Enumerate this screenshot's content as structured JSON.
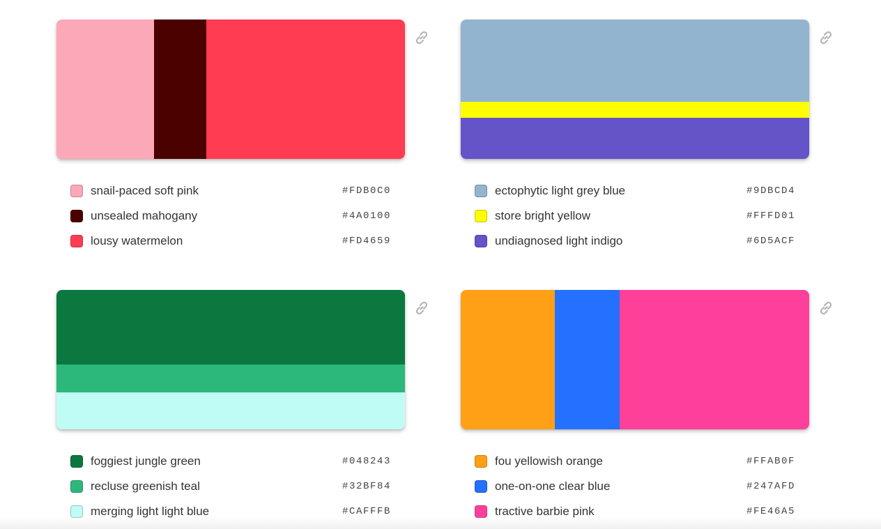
{
  "palettes": [
    {
      "orientation": "horizontal",
      "colors": [
        {
          "name": "snail-paced soft pink",
          "hex": "#FDB0C0",
          "color": "#FDA8B8",
          "share": 28
        },
        {
          "name": "unsealed mahogany",
          "hex": "#4A0100",
          "color": "#4A0100",
          "share": 15
        },
        {
          "name": "lousy watermelon",
          "hex": "#FD4659",
          "color": "#FF3C52",
          "share": 57
        }
      ]
    },
    {
      "orientation": "vertical",
      "colors": [
        {
          "name": "ectophytic light grey blue",
          "hex": "#9DBCD4",
          "color": "#93B4CF",
          "share": 59
        },
        {
          "name": "store bright yellow",
          "hex": "#FFFD01",
          "color": "#FFFD01",
          "share": 11.5
        },
        {
          "name": "undiagnosed light indigo",
          "hex": "#6D5ACF",
          "color": "#6553C8",
          "share": 29.5
        }
      ]
    },
    {
      "orientation": "vertical",
      "colors": [
        {
          "name": "foggiest jungle green",
          "hex": "#048243",
          "color": "#0A783F",
          "share": 53.5
        },
        {
          "name": "recluse greenish teal",
          "hex": "#32BF84",
          "color": "#2DB87B",
          "share": 20
        },
        {
          "name": "merging light light blue",
          "hex": "#CAFFFB",
          "color": "#C0FCF6",
          "share": 26.5
        }
      ]
    },
    {
      "orientation": "horizontal",
      "colors": [
        {
          "name": "fou yellowish orange",
          "hex": "#FFAB0F",
          "color": "#FFA016",
          "share": 27
        },
        {
          "name": "one-on-one clear blue",
          "hex": "#247AFD",
          "color": "#2470FF",
          "share": 18.5
        },
        {
          "name": "tractive barbie pink",
          "hex": "#FE46A5",
          "color": "#FF409B",
          "share": 54.5
        }
      ]
    }
  ],
  "link_icon": "link-chain-icon"
}
